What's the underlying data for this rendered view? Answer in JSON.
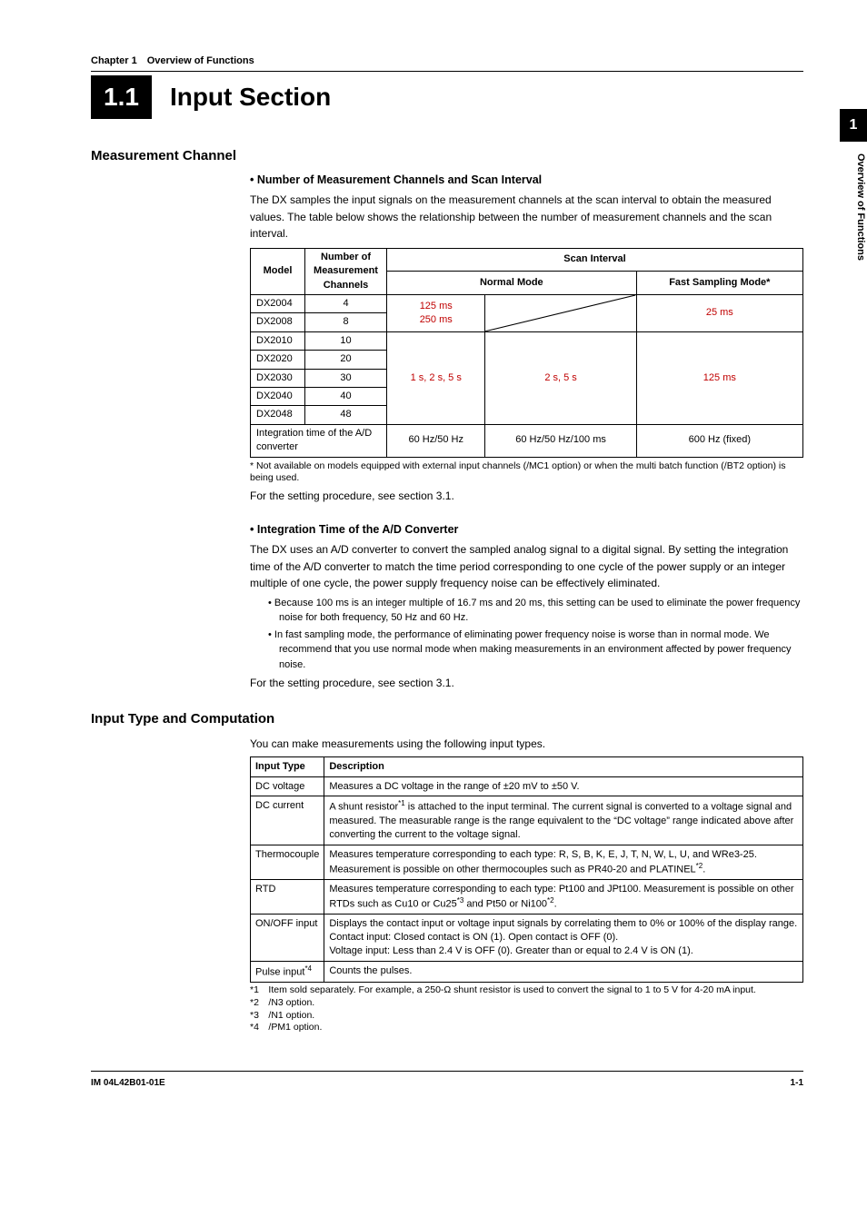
{
  "side": {
    "num": "1",
    "text": "Overview of Functions"
  },
  "chapterLine": "Chapter 1 Overview of Functions",
  "heading": {
    "num": "1.1",
    "text": "Input Section"
  },
  "s1": {
    "h2": "Measurement Channel",
    "h3a": "Number of Measurement Channels and Scan Interval",
    "p1": "The DX samples the input signals on the measurement channels at the scan interval to obtain the measured values. The table below shows the relationship between the number of measurement channels and the scan interval.",
    "t1": {
      "h_model": "Model",
      "h_chan": "Number of Measurement Channels",
      "h_scan": "Scan Interval",
      "h_normal": "Normal Mode",
      "h_fast": "Fast Sampling Mode*",
      "rows": [
        {
          "model": "DX2004",
          "ch": "4"
        },
        {
          "model": "DX2008",
          "ch": "8"
        },
        {
          "model": "DX2010",
          "ch": "10"
        },
        {
          "model": "DX2020",
          "ch": "20"
        },
        {
          "model": "DX2030",
          "ch": "30"
        },
        {
          "model": "DX2040",
          "ch": "40"
        },
        {
          "model": "DX2048",
          "ch": "48"
        }
      ],
      "g1_left": "125 ms\n250 ms",
      "g1_fast": "25 ms",
      "g2_left": "1 s, 2 s, 5 s",
      "g2_right": "2 s, 5 s",
      "g2_fast": "125 ms",
      "adrow_label": "Integration time of the A/D converter",
      "ad_c1": "60 Hz/50 Hz",
      "ad_c2": "60 Hz/50 Hz/100 ms",
      "ad_c3": "600 Hz (fixed)"
    },
    "fn1a": "Not available on models equipped with external input channels (/MC1 option) or when the multi batch function (/BT2 option) is being used.",
    "ref1": "For the setting procedure, see section 3.1.",
    "h3b": "Integration Time of the A/D Converter",
    "p2": "The DX uses an A/D converter to convert the sampled analog signal to a digital signal. By setting the integration time of the A/D converter to match the time period corresponding to one cycle of the power supply or an integer multiple of one cycle, the power supply frequency noise can be effectively eliminated.",
    "b1": "Because 100 ms is an integer multiple of 16.7 ms and 20 ms, this setting can be used to eliminate the power frequency noise for both frequency, 50 Hz and 60 Hz.",
    "b2": "In fast sampling mode, the performance of eliminating power frequency noise is worse than in normal mode. We recommend that you use normal mode when making measurements in an environment affected by power frequency noise.",
    "ref2": "For the setting procedure, see section 3.1."
  },
  "s2": {
    "h2": "Input Type and Computation",
    "intro": "You can make measurements using the following input types.",
    "t2": {
      "h1": "Input Type",
      "h2": "Description",
      "rows": [
        {
          "type": "DC voltage",
          "desc_html": "Measures a DC voltage in the range of ±20 mV to ±50 V."
        },
        {
          "type": "DC current",
          "desc_html": "A shunt resistor<span class='sup'>*1</span> is attached to the input terminal.  The current signal is converted to a voltage signal and measured.  The measurable range is the range equivalent to the “DC voltage” range indicated above after converting the current to the voltage signal."
        },
        {
          "type": "Thermocouple",
          "desc_html": "Measures temperature corresponding to each type: R, S, B, K, E, J, T, N, W, L, U, and WRe3-25.  Measurement is possible on other thermocouples such as PR40-20 and PLATINEL<span class='sup'>*2</span>."
        },
        {
          "type": "RTD",
          "desc_html": "Measures temperature corresponding to each type: Pt100 and JPt100.  Measurement is possible on other RTDs such as Cu10 or Cu25<span class='sup'>*3</span> and Pt50 or Ni100<span class='sup'>*2</span>."
        },
        {
          "type": "ON/OFF input",
          "desc_html": "Displays the contact input or voltage input signals by correlating them to 0% or 100% of the display range.<br>Contact input: Closed contact is ON (1).  Open contact is OFF (0).<br>Voltage input: Less than 2.4 V is OFF (0).  Greater than or equal to 2.4 V is ON (1)."
        },
        {
          "type_html": "Pulse input<span class='sup'>*4</span>",
          "desc_html": "Counts the pulses."
        }
      ]
    },
    "fn": {
      "l1": "*1 Item sold separately.  For example, a 250-Ω shunt resistor is used to convert the signal to 1 to 5 V for 4-20 mA input.",
      "l2": "*2 /N3 option.",
      "l3": "*3 /N1 option.",
      "l4": "*4 /PM1 option."
    }
  },
  "footer": {
    "left": "IM 04L42B01-01E",
    "right": "1-1"
  }
}
